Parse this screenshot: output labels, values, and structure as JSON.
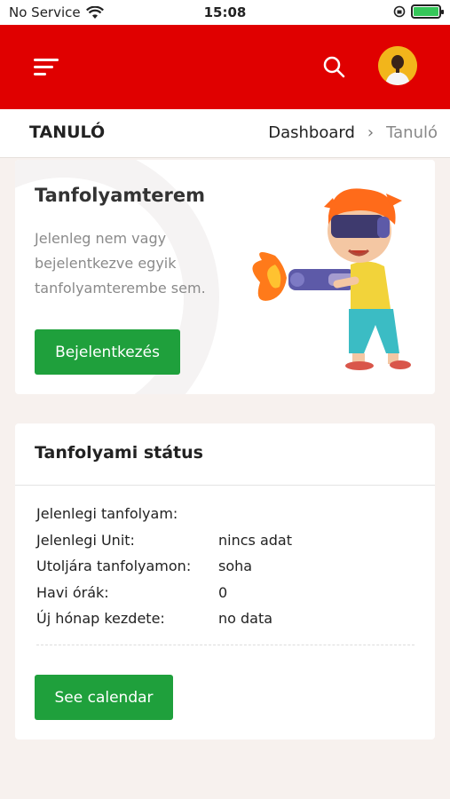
{
  "status_bar": {
    "carrier": "No Service",
    "time": "15:08"
  },
  "header": {
    "page_title": "TANULÓ",
    "breadcrumb": [
      "Dashboard",
      "Tanuló"
    ]
  },
  "classroom_card": {
    "title": "Tanfolyamterem",
    "description": "Jelenleg nem vagy bejelentkezve egyik tanfolyamterembe sem.",
    "login_button": "Bejelentkezés"
  },
  "status_card": {
    "title": "Tanfolyami státus",
    "rows": [
      {
        "label": "Jelenlegi tanfolyam:",
        "value": ""
      },
      {
        "label": "Jelenlegi Unit:",
        "value": "nincs adat"
      },
      {
        "label": "Utoljára tanfolyamon:",
        "value": "soha"
      },
      {
        "label": "Havi órák:",
        "value": "0"
      },
      {
        "label": "Új hónap kezdete:",
        "value": "no data"
      }
    ],
    "calendar_button": "See calendar"
  },
  "colors": {
    "brand_red": "#e00000",
    "button_green": "#1fa03c"
  },
  "icons": [
    "wifi-icon",
    "orientation-lock-icon",
    "battery-icon",
    "menu-icon",
    "search-icon",
    "avatar",
    "chevron-right-icon"
  ]
}
